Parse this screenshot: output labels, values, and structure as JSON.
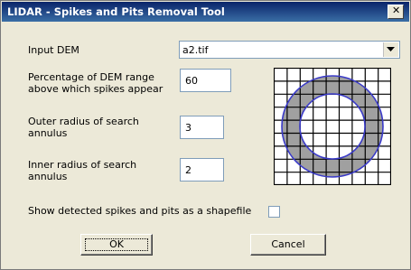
{
  "window": {
    "title": "LIDAR - Spikes and Pits Removal Tool"
  },
  "fields": {
    "input_dem_label": "Input DEM",
    "input_dem_value": "a2.tif",
    "percentage_label_line1": "Percentage of DEM range",
    "percentage_label_line2": "above which spikes appear",
    "percentage_value": "60",
    "outer_radius_label_line1": "Outer radius of search",
    "outer_radius_label_line2": "annulus",
    "outer_radius_value": "3",
    "inner_radius_label_line1": "Inner radius of search",
    "inner_radius_label_line2": "annulus",
    "inner_radius_value": "2",
    "shapefile_label": "Show detected spikes and pits as a shapefile",
    "shapefile_checked": false
  },
  "buttons": {
    "ok": "OK",
    "cancel": "Cancel"
  },
  "icons": {
    "close": "close-icon",
    "dropdown": "chevron-down-icon",
    "diagram": "annulus-grid-diagram"
  },
  "colors": {
    "titlebar": "#0a246a",
    "annulus_fill": "#a0a0a0",
    "circle_stroke": "#3a3ac8"
  }
}
